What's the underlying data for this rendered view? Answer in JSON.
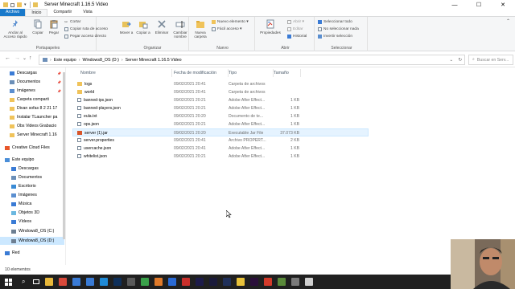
{
  "window": {
    "title": "Server Minecraft 1.16.5 Video",
    "controls": [
      "—",
      "☐",
      "✕"
    ]
  },
  "ribbon_tabs": [
    {
      "label": "Archivo"
    },
    {
      "label": "Inicio"
    },
    {
      "label": "Compartir"
    },
    {
      "label": "Vista"
    }
  ],
  "ribbon": {
    "portapapeles": {
      "label": "Portapapeles",
      "anclar": "Anclar al Acceso rápido",
      "copiar": "Copiar",
      "pegar": "Pegar",
      "cortar": "Cortar",
      "copiar_ruta": "Copiar ruta de acceso",
      "pegar_acceso": "Pegar acceso directo"
    },
    "organizar": {
      "label": "Organizar",
      "mover": "Mover a",
      "copiar_a": "Copiar a",
      "eliminar": "Eliminar",
      "cambiar": "Cambiar nombre"
    },
    "nuevo": {
      "label": "Nuevo",
      "nueva_carpeta": "Nueva carpeta",
      "nuevo_elemento": "Nuevo elemento ▾",
      "facil_acceso": "Fácil acceso ▾"
    },
    "abrir": {
      "label": "Abrir",
      "propiedades": "Propiedades",
      "abrir": "Abrir ▾",
      "editar": "Editar",
      "historial": "Historial"
    },
    "seleccionar": {
      "label": "Seleccionar",
      "todo": "Seleccionar todo",
      "nada": "No seleccionar nada",
      "invertir": "Invertir selección"
    }
  },
  "address": {
    "nav": [
      "←",
      "→",
      "⌄",
      "↑"
    ],
    "crumbs": [
      "Este equipo",
      "Windows8_OS (D:)",
      "Server Minecraft 1.16.5 Video"
    ],
    "search_placeholder": "Buscar en Serv..."
  },
  "sidebar": {
    "items": [
      {
        "label": "Descargas",
        "pinned": true,
        "color": "#3a7bd5"
      },
      {
        "label": "Documentos",
        "pinned": true,
        "color": "#6b8fb8"
      },
      {
        "label": "Imágenes",
        "pinned": true,
        "color": "#5b8fd0"
      },
      {
        "label": "Carpeta comparti",
        "pinned": false,
        "color": "#f0c35a"
      },
      {
        "label": "Divan sofas 8 2 21 17",
        "pinned": false,
        "color": "#f0c35a"
      },
      {
        "label": "Instalar TLauncher pa",
        "pinned": false,
        "color": "#f0c35a"
      },
      {
        "label": "Obs Videos Grabacio",
        "pinned": false,
        "color": "#f0c35a"
      },
      {
        "label": "Server Minecraft 1.16",
        "pinned": false,
        "color": "#f0c35a"
      },
      {
        "label": "Creative Cloud Files",
        "pinned": false,
        "color": "#e8562a"
      },
      {
        "label": "Este equipo",
        "pinned": false,
        "color": "#4a8ed8"
      },
      {
        "label": "Descargas",
        "pinned": false,
        "color": "#3a7bd5"
      },
      {
        "label": "Documentos",
        "pinned": false,
        "color": "#6b8fb8"
      },
      {
        "label": "Escritorio",
        "pinned": false,
        "color": "#3a8bd5"
      },
      {
        "label": "Imágenes",
        "pinned": false,
        "color": "#5b8fd0"
      },
      {
        "label": "Música",
        "pinned": false,
        "color": "#3a7bd5"
      },
      {
        "label": "Objetos 3D",
        "pinned": false,
        "color": "#6bb8e0"
      },
      {
        "label": "Vídeos",
        "pinned": false,
        "color": "#3a7bd5"
      },
      {
        "label": "Windows8_OS (C:)",
        "pinned": false,
        "color": "#6d7f92"
      },
      {
        "label": "Windows8_OS (D:)",
        "pinned": false,
        "color": "#6d7f92"
      },
      {
        "label": "Red",
        "pinned": false,
        "color": "#3a7bd5"
      }
    ]
  },
  "columns": {
    "name": "Nombre",
    "date": "Fecha de modificación",
    "type": "Tipo",
    "size": "Tamaño"
  },
  "files": [
    {
      "name": "logs",
      "date": "09/02/2021 20:41",
      "type": "Carpeta de archivos",
      "size": "",
      "icon": "folder-icon"
    },
    {
      "name": "world",
      "date": "09/02/2021 20:41",
      "type": "Carpeta de archivos",
      "size": "",
      "icon": "folder-icon"
    },
    {
      "name": "banned-ips.json",
      "date": "09/02/2021 20:21",
      "type": "Adobe After Effect...",
      "size": "1 KB",
      "icon": "json-file-icon"
    },
    {
      "name": "banned-players.json",
      "date": "09/02/2021 20:21",
      "type": "Adobe After Effect...",
      "size": "1 KB",
      "icon": "json-file-icon"
    },
    {
      "name": "eula.txt",
      "date": "09/02/2021 20:20",
      "type": "Documento de te...",
      "size": "1 KB",
      "icon": "text-file-icon"
    },
    {
      "name": "ops.json",
      "date": "09/02/2021 20:21",
      "type": "Adobe After Effect...",
      "size": "1 KB",
      "icon": "json-file-icon"
    },
    {
      "name": "server (1).jar",
      "date": "09/02/2021 20:20",
      "type": "Executable Jar File",
      "size": "37.073 KB",
      "icon": "jar-file-icon"
    },
    {
      "name": "server.properties",
      "date": "09/02/2021 20:41",
      "type": "Archivo PROPERT...",
      "size": "2 KB",
      "icon": "file-icon"
    },
    {
      "name": "usercache.json",
      "date": "09/02/2021 20:41",
      "type": "Adobe After Effect...",
      "size": "1 KB",
      "icon": "json-file-icon"
    },
    {
      "name": "whitelist.json",
      "date": "09/02/2021 20:21",
      "type": "Adobe After Effect...",
      "size": "1 KB",
      "icon": "json-file-icon"
    }
  ],
  "status": {
    "count": "10 elementos"
  },
  "taskbar": {
    "apps": [
      {
        "name": "start",
        "color": "#202020"
      },
      {
        "name": "search",
        "color": "#202020"
      },
      {
        "name": "task-view",
        "color": "#202020"
      },
      {
        "name": "file-explorer",
        "color": "#e8b83a"
      },
      {
        "name": "chrome",
        "color": "#d9493a"
      },
      {
        "name": "store",
        "color": "#3a7bd5"
      },
      {
        "name": "mail",
        "color": "#3a7bd5"
      },
      {
        "name": "edge",
        "color": "#1f8ad6"
      },
      {
        "name": "photoshop",
        "color": "#0e2f5a"
      },
      {
        "name": "app-gray",
        "color": "#5a5a5a"
      },
      {
        "name": "app-green",
        "color": "#3aa14a"
      },
      {
        "name": "app-orange",
        "color": "#e07a2a"
      },
      {
        "name": "app-blue",
        "color": "#2a6ad5"
      },
      {
        "name": "acrobat",
        "color": "#c9302c"
      },
      {
        "name": "after-effects",
        "color": "#1d1b4a"
      },
      {
        "name": "media-encoder",
        "color": "#1a1a3a"
      },
      {
        "name": "app-darkblue",
        "color": "#20305a"
      },
      {
        "name": "app-yellow",
        "color": "#e8c23a"
      },
      {
        "name": "premiere",
        "color": "#2a0f3a"
      },
      {
        "name": "app-red",
        "color": "#d33a2a"
      },
      {
        "name": "minecraft",
        "color": "#5a8a3a"
      },
      {
        "name": "app-gray2",
        "color": "#7a7a7a"
      },
      {
        "name": "app-white",
        "color": "#cfcfcf"
      }
    ]
  }
}
